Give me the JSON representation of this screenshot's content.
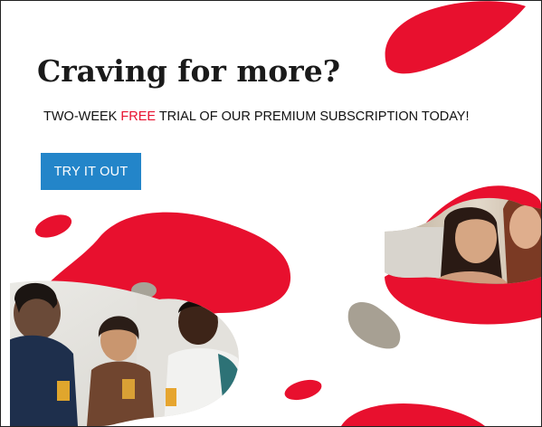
{
  "banner": {
    "headline": "Craving for more?",
    "subline": {
      "before": "TWO-WEEK ",
      "highlight": "FREE",
      "after": " TRIAL OF OUR PREMIUM SUBSCRIPTION TODAY!"
    },
    "cta_label": "TRY IT OUT"
  },
  "colors": {
    "accent": "#e8102e",
    "button": "#2385c9",
    "text": "#1a1a1a",
    "background": "#ffffff"
  }
}
